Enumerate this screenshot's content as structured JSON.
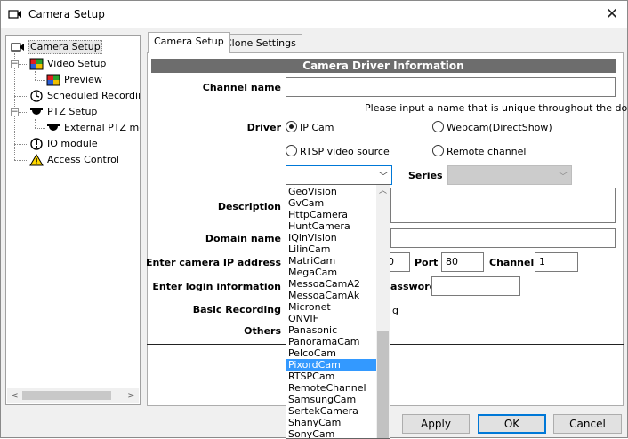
{
  "window": {
    "title": "Camera Setup"
  },
  "tree": {
    "items": [
      {
        "label": "Camera Setup",
        "icon": "camera-icon"
      },
      {
        "label": "Video Setup",
        "icon": "video-grid-icon"
      },
      {
        "label": "Preview",
        "icon": "preview-grid-icon"
      },
      {
        "label": "Scheduled Recording",
        "icon": "clock-icon"
      },
      {
        "label": "PTZ Setup",
        "icon": "dome-camera-icon"
      },
      {
        "label": "External PTZ mod",
        "icon": "dome-camera-icon"
      },
      {
        "label": "IO module",
        "icon": "io-alert-icon"
      },
      {
        "label": "Access Control",
        "icon": "warning-icon"
      }
    ]
  },
  "tabs": [
    {
      "label": "Camera Setup"
    },
    {
      "label": "Clone Settings"
    }
  ],
  "section_title": "Camera Driver Information",
  "form": {
    "channel_name_label": "Channel name",
    "channel_name_value": "",
    "channel_hint": "Please input a name that is unique throughout the domain.",
    "driver_label": "Driver",
    "driver_options": [
      "IP Cam",
      "Webcam(DirectShow)",
      "RTSP video source",
      "Remote channel"
    ],
    "driver_selected": "IP Cam",
    "series_label": "Series",
    "description_label": "Description",
    "domain_name_label": "Domain name",
    "ip_label": "Enter camera IP address",
    "ip_partial": "0",
    "port_label": "Port",
    "port_value": "80",
    "channel_label": "Channel",
    "channel_value": "1",
    "login_label": "Enter login information",
    "password_label_partial": "assword",
    "basic_recording_label": "Basic Recording",
    "basic_recording_partial": "g",
    "others_label": "Others"
  },
  "dropdown": {
    "options": [
      "GeoVision",
      "GvCam",
      "HttpCamera",
      "HuntCamera",
      "IQinVision",
      "LilinCam",
      "MatriCam",
      "MegaCam",
      "MessoaCamA2",
      "MessoaCamAk",
      "Micronet",
      "ONVIF",
      "Panasonic",
      "PanoramaCam",
      "PelcoCam",
      "PixordCam",
      "RTSPCam",
      "RemoteChannel",
      "SamsungCam",
      "SertekCamera",
      "ShanyCam",
      "SonyCam"
    ],
    "highlighted": "PixordCam"
  },
  "buttons": {
    "apply": "Apply",
    "ok": "OK",
    "cancel": "Cancel"
  },
  "colors": {
    "header_bar": "#6d6d6d",
    "highlight": "#3399ff",
    "focus": "#0078d7"
  }
}
